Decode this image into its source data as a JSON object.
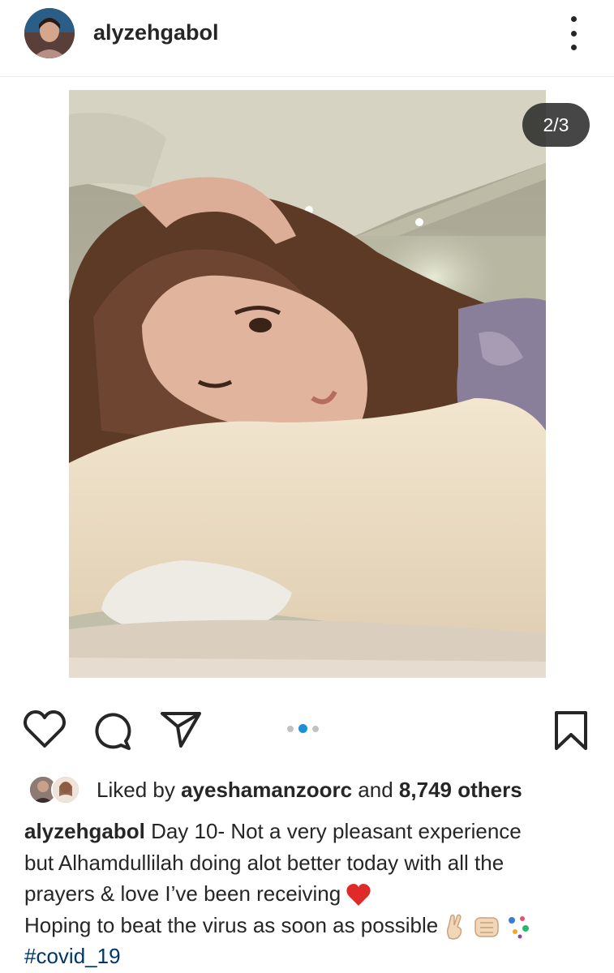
{
  "post": {
    "username": "alyzehgabol",
    "image_counter": "2/3",
    "carousel": {
      "count": 3,
      "active": 2
    }
  },
  "likes": {
    "prefix": "Liked by",
    "user": "ayeshamanzoorc",
    "middle": "and",
    "count": "8,749 others"
  },
  "caption": {
    "username": "alyzehgabol",
    "line1": "Day 10- Not a very pleasant experience",
    "line2": "but Alhamdullilah doing alot better today with all the",
    "line3": "prayers & love I’ve been receiving",
    "line4": "Hoping to beat the virus as soon as possible",
    "hashtag": "#covid_19"
  },
  "icons": [
    "more-options-icon",
    "heart-icon",
    "comment-icon",
    "share-icon",
    "bookmark-icon",
    "red-heart-emoji",
    "crossed-fingers-emoji",
    "fist-bump-emoji",
    "sparkles-emoji"
  ],
  "colors": {
    "accent_dot": "#1f8fd8",
    "hashtag": "#00376b",
    "text": "#262626",
    "counter_bg": "#262626"
  }
}
